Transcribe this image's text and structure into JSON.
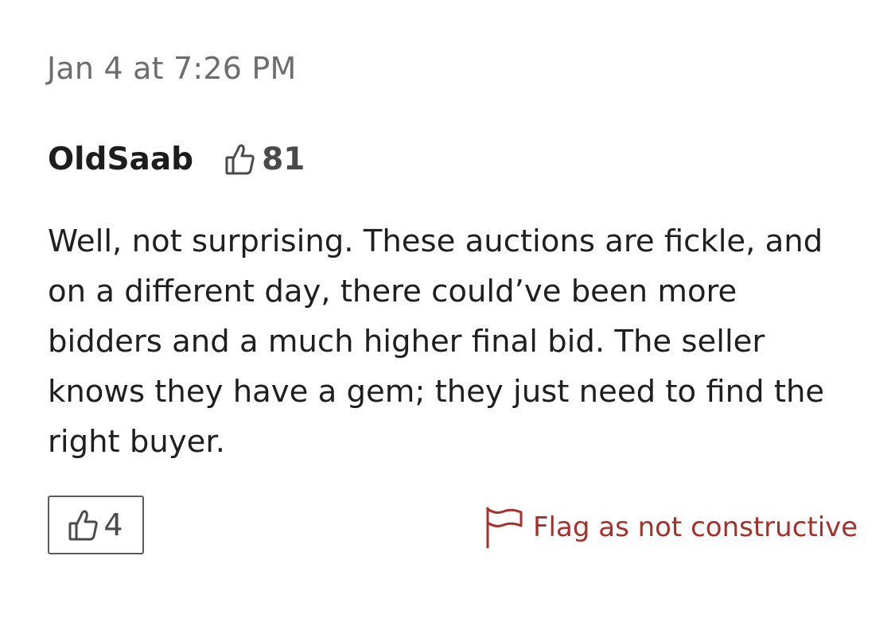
{
  "comment": {
    "timestamp": "Jan 4 at 7:26 PM",
    "author": {
      "name": "OldSaab",
      "reputation_score": "81",
      "reputation_icon": "thumbs-up-icon"
    },
    "body": "Well, not surprising. These auctions are fickle, and on a different day, there could’ve been more bidders and a much higher final bid. The seller knows they have a gem; they just need to find the right buyer.",
    "like_button": {
      "icon": "thumbs-up-icon",
      "count": "4"
    },
    "flag_link": {
      "icon": "flag-icon",
      "label": "Flag as not constructive"
    }
  },
  "colors": {
    "text_primary": "#1f1f1f",
    "text_muted": "#6d6d6d",
    "icon_gray": "#4a4a4a",
    "flag_red": "#a5302c",
    "button_border": "#5c5c5c",
    "background": "#ffffff"
  }
}
